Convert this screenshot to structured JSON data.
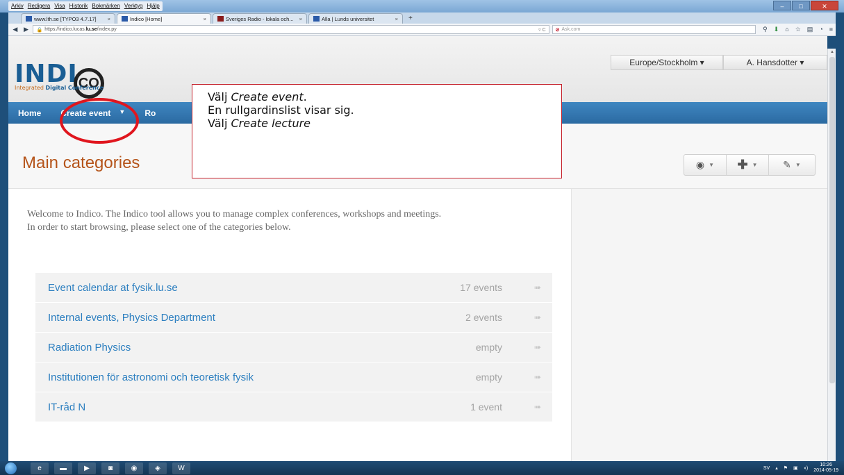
{
  "browser": {
    "menu": [
      "Arkiv",
      "Redigera",
      "Visa",
      "Historik",
      "Bokmärken",
      "Verktyg",
      "Hjälp"
    ],
    "tabs": [
      {
        "label": "www.lth.se [TYPO3 4.7.17]",
        "active": false
      },
      {
        "label": "Indico [Home]",
        "active": true
      },
      {
        "label": "Sveriges Radio - lokala och...",
        "active": false
      },
      {
        "label": "Alla | Lunds universitet",
        "active": false
      }
    ],
    "url_prefix": "https://indico.lucas.",
    "url_domain": "lu.se",
    "url_path": "/index.py",
    "search_placeholder": "Ask.com"
  },
  "site": {
    "logo_word": "INDI",
    "logo_co": "CO",
    "tagline_prefix": "Integrated",
    "tagline_bold": "Digital",
    "tagline_suffix": "Conference",
    "timezone": "Europe/Stockholm ▾",
    "user": "A. Hansdotter ▾"
  },
  "nav": {
    "home": "Home",
    "create_event": "Create event",
    "create_event_caret": "▼",
    "room": "Ro"
  },
  "page": {
    "title": "Main categories",
    "welcome_line1": "Welcome to Indico. The Indico tool allows you to manage complex conferences, workshops and meetings.",
    "welcome_line2": "In order to start browsing, please select one of the categories below."
  },
  "categories": [
    {
      "name": "Event calendar at fysik.lu.se",
      "count": "17 events"
    },
    {
      "name": "Internal events, Physics Department",
      "count": "2 events"
    },
    {
      "name": "Radiation Physics",
      "count": "empty"
    },
    {
      "name": "Institutionen för astronomi och teoretisk fysik",
      "count": "empty"
    },
    {
      "name": "IT-råd N",
      "count": "1 event"
    }
  ],
  "callout": {
    "line1_prefix": "Välj ",
    "line1_italic": "Create event",
    "line1_suffix": ".",
    "line2": "En rullgardinslist visar sig.",
    "line3_prefix": "Välj ",
    "line3_italic": "Create lecture"
  },
  "taskbar": {
    "lang": "SV",
    "time": "10:26",
    "date": "2014-05-19"
  },
  "colors": {
    "accent": "#2b6aa1",
    "title": "#b5541a",
    "link": "#2c7fc0",
    "highlight": "#e0161e"
  }
}
